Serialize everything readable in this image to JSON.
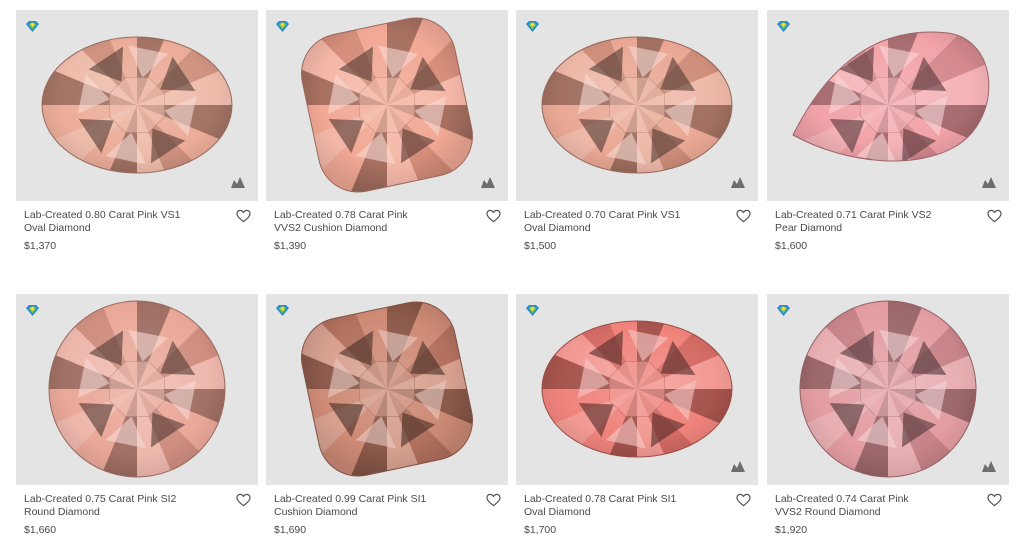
{
  "accent": {
    "badge_green": "#7ac143",
    "badge_blue": "#1e88e5",
    "heart_stroke": "#555555",
    "image_bg": "#e4e4e4"
  },
  "products": [
    {
      "title_line1": "Lab-Created 0.80 Carat Pink VS1",
      "title_line2": "Oval Diamond",
      "price": "$1,370",
      "shape": "oval",
      "tone": "#e9a58f",
      "show_360": true,
      "badge_icon": "lab-created-badge-icon",
      "heart_icon": "heart-icon"
    },
    {
      "title_line1": "Lab-Created 0.78 Carat Pink",
      "title_line2": "VVS2 Cushion Diamond",
      "price": "$1,390",
      "shape": "cushion",
      "tone": "#f0a08a",
      "show_360": true,
      "badge_icon": "lab-created-badge-icon",
      "heart_icon": "heart-icon"
    },
    {
      "title_line1": "Lab-Created 0.70 Carat Pink VS1",
      "title_line2": "Oval Diamond",
      "price": "$1,500",
      "shape": "oval",
      "tone": "#e7a08a",
      "show_360": true,
      "badge_icon": "lab-created-badge-icon",
      "heart_icon": "heart-icon"
    },
    {
      "title_line1": "Lab-Created 0.71 Carat Pink VS2",
      "title_line2": "Pear Diamond",
      "price": "$1,600",
      "shape": "pear",
      "tone": "#f09aa0",
      "show_360": true,
      "badge_icon": "lab-created-badge-icon",
      "heart_icon": "heart-icon"
    },
    {
      "title_line1": "Lab-Created 0.75 Carat Pink SI2",
      "title_line2": "Round Diamond",
      "price": "$1,660",
      "shape": "round",
      "tone": "#e8a090",
      "show_360": false,
      "badge_icon": "lab-created-badge-icon",
      "heart_icon": "heart-icon"
    },
    {
      "title_line1": "Lab-Created 0.99 Carat Pink SI1",
      "title_line2": "Cushion Diamond",
      "price": "$1,690",
      "shape": "cushion",
      "tone": "#c9806a",
      "show_360": false,
      "badge_icon": "lab-created-badge-icon",
      "heart_icon": "heart-icon"
    },
    {
      "title_line1": "Lab-Created 0.78 Carat Pink SI1",
      "title_line2": "Oval Diamond",
      "price": "$1,700",
      "shape": "oval",
      "tone": "#ee7870",
      "show_360": true,
      "badge_icon": "lab-created-badge-icon",
      "heart_icon": "heart-icon"
    },
    {
      "title_line1": "Lab-Created 0.74 Carat Pink",
      "title_line2": "VVS2 Round Diamond",
      "price": "$1,920",
      "shape": "round",
      "tone": "#e0949a",
      "show_360": true,
      "badge_icon": "lab-created-badge-icon",
      "heart_icon": "heart-icon"
    }
  ]
}
